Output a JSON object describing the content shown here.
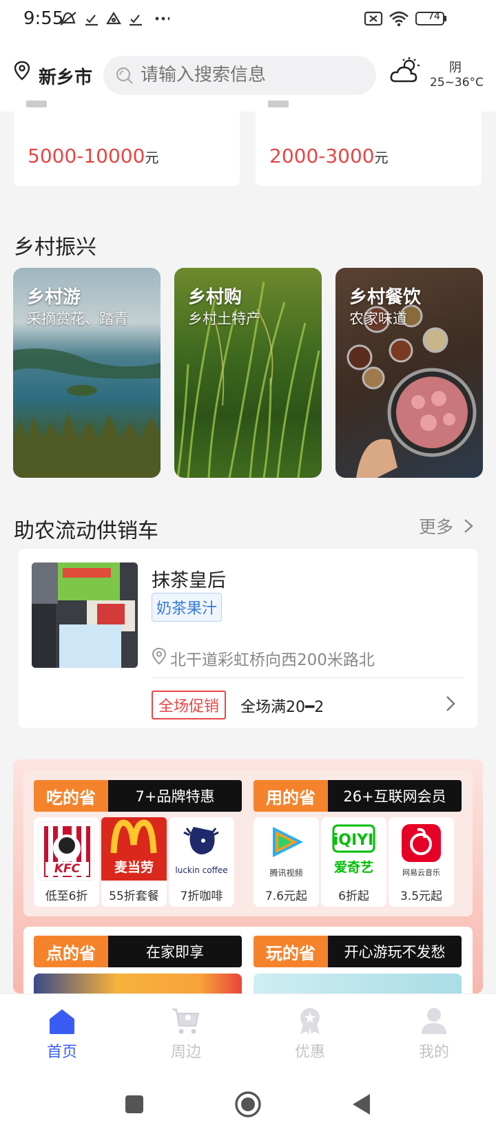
{
  "status_bar": {
    "time": "9:55",
    "battery": "74"
  },
  "header": {
    "city": "新乡市",
    "search_placeholder": "请输入搜索信息",
    "weather": {
      "condition": "阴",
      "temp": "25~36°C"
    }
  },
  "jobs": [
    {
      "salary": "5000-10000",
      "unit": "元"
    },
    {
      "salary": "2000-3000",
      "unit": "元"
    }
  ],
  "rural": {
    "title": "乡村振兴",
    "tiles": [
      {
        "title": "乡村游",
        "subtitle": "采摘赏花、踏青"
      },
      {
        "title": "乡村购",
        "subtitle": "乡村土特产"
      },
      {
        "title": "乡村餐饮",
        "subtitle": "农家味道"
      }
    ]
  },
  "truck": {
    "title": "助农流动供销车",
    "more": "更多",
    "shop": {
      "name": "抹茶皇后",
      "tag": "奶茶果汁",
      "address": "北干道彩虹桥向西200米路北",
      "promo_label": "全场促销",
      "promo_text": "全场满20━2"
    }
  },
  "benefits": {
    "groups": [
      {
        "label": "吃的省",
        "desc": "7+品牌特惠",
        "items": [
          {
            "logo": "KFC",
            "caption": "低至6折"
          },
          {
            "logo": "麦当劳",
            "caption": "55折套餐"
          },
          {
            "logo": "luckin coffee",
            "caption": "7折咖啡"
          }
        ]
      },
      {
        "label": "用的省",
        "desc": "26+互联网会员",
        "items": [
          {
            "logo": "腾讯视频",
            "caption": "7.6元起"
          },
          {
            "logo": "爱奇艺",
            "caption": "6折起"
          },
          {
            "logo": "网易云音乐",
            "caption": "3.5元起"
          }
        ]
      },
      {
        "label": "点的省",
        "desc": "在家即享"
      },
      {
        "label": "玩的省",
        "desc": "开心游玩不发愁"
      }
    ]
  },
  "tabbar": [
    {
      "label": "首页",
      "icon": "home-icon",
      "active": true
    },
    {
      "label": "周边",
      "icon": "cart-location-icon",
      "active": false
    },
    {
      "label": "优惠",
      "icon": "badge-icon",
      "active": false
    },
    {
      "label": "我的",
      "icon": "user-icon",
      "active": false
    }
  ],
  "colors": {
    "accent": "#3a5cf5",
    "price": "#e84545",
    "benefit_orange": "#f5832c"
  }
}
